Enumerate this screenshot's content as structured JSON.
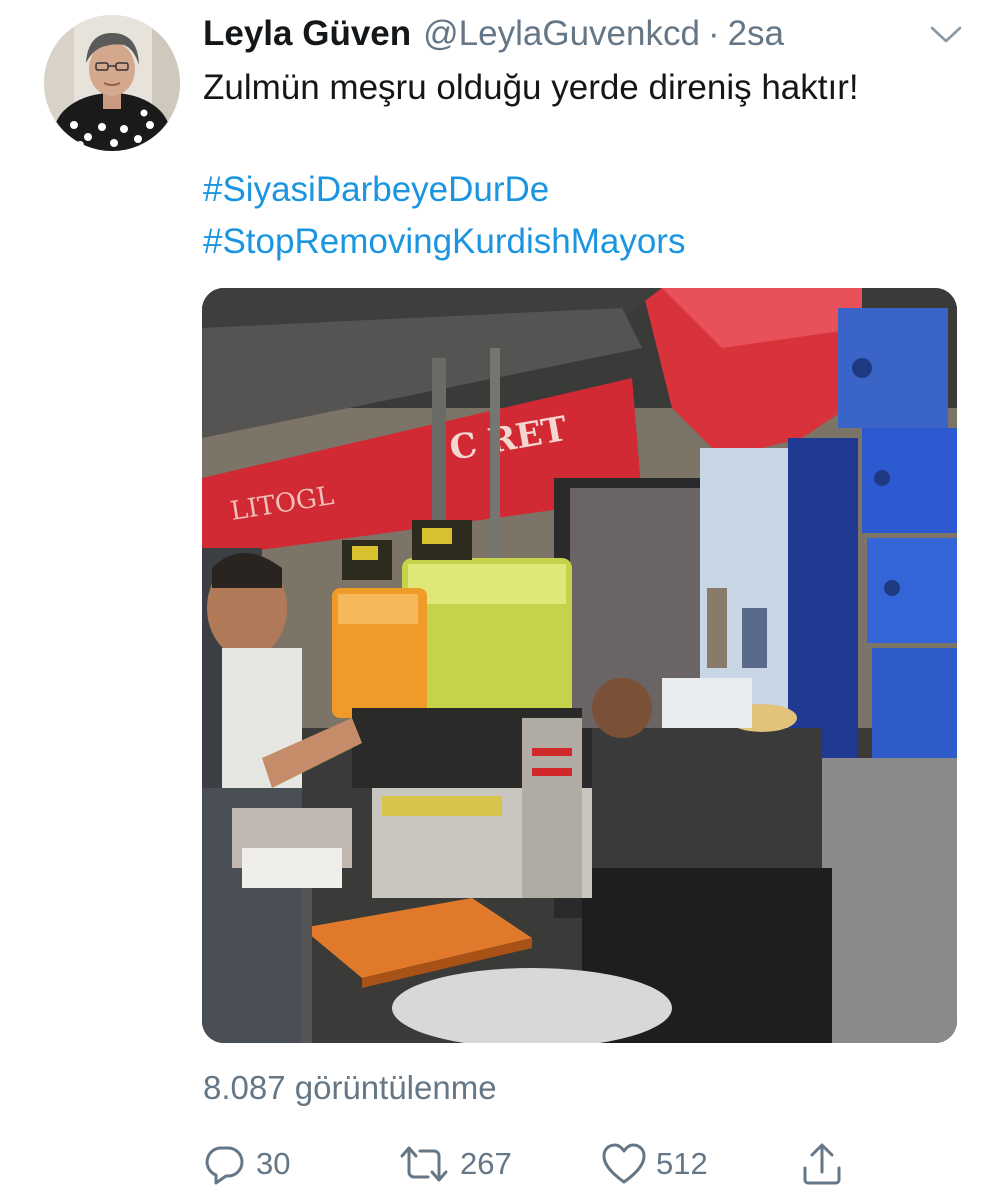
{
  "tweet": {
    "display_name": "Leyla Güven",
    "handle": "@LeylaGuvenkcd",
    "separator": "·",
    "time": "2sa",
    "text": "Zulmün meşru olduğu yerde direniş haktır!",
    "hashtags": [
      "#SiyasiDarbeyeDurDe",
      "#StopRemovingKurdishMayors"
    ],
    "views": "8.087 görüntülenme",
    "avatar": "profile-photo",
    "media": "video-thumbnail"
  },
  "actions": {
    "reply": {
      "icon": "reply-icon",
      "count": "30"
    },
    "retweet": {
      "icon": "retweet-icon",
      "count": "267"
    },
    "like": {
      "icon": "heart-icon",
      "count": "512"
    },
    "share": {
      "icon": "share-icon"
    }
  },
  "colors": {
    "text": "#14171a",
    "secondary": "#657786",
    "link": "#1b95e0",
    "background": "#ffffff"
  }
}
